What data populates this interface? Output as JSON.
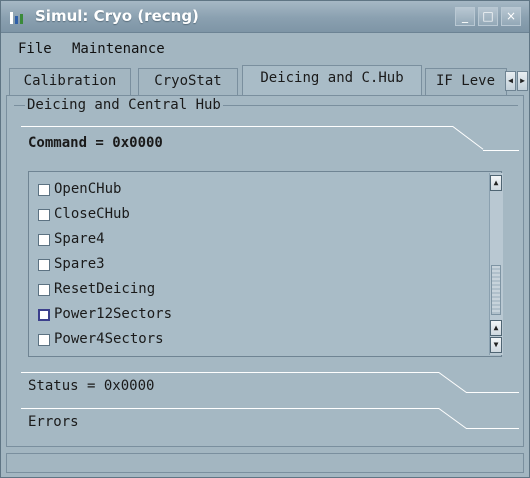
{
  "window": {
    "title": "Simul: Cryo (recng)",
    "controls": {
      "minimize": "_",
      "maximize": "□",
      "close": "×"
    }
  },
  "menu": {
    "file": "File",
    "maintenance": "Maintenance"
  },
  "tabs": [
    {
      "label": "Calibration",
      "active": false
    },
    {
      "label": "CryoStat",
      "active": false
    },
    {
      "label": "Deicing and C.Hub",
      "active": true
    },
    {
      "label": "IF Leve",
      "active": false
    }
  ],
  "tab_scroll": {
    "left": "◀",
    "right": "▶"
  },
  "group": {
    "legend": "Deicing and Central Hub"
  },
  "command": {
    "label": "Command = 0x0000"
  },
  "list": {
    "items": [
      {
        "label": "OpenCHub",
        "checked": false
      },
      {
        "label": "CloseCHub",
        "checked": false
      },
      {
        "label": "Spare4",
        "checked": false
      },
      {
        "label": "Spare3",
        "checked": false
      },
      {
        "label": "ResetDeicing",
        "checked": false
      },
      {
        "label": "Power12Sectors",
        "checked": false,
        "focused": true
      },
      {
        "label": "Power4Sectors",
        "checked": false
      }
    ],
    "scroll_up": "▲",
    "scroll_down": "▼"
  },
  "status": {
    "label": "Status = 0x0000"
  },
  "errors": {
    "label": "Errors"
  },
  "colors": {
    "titlebar": "#8aa0b0",
    "panel": "#a5b8c3",
    "focus": "#3b3f8c"
  }
}
